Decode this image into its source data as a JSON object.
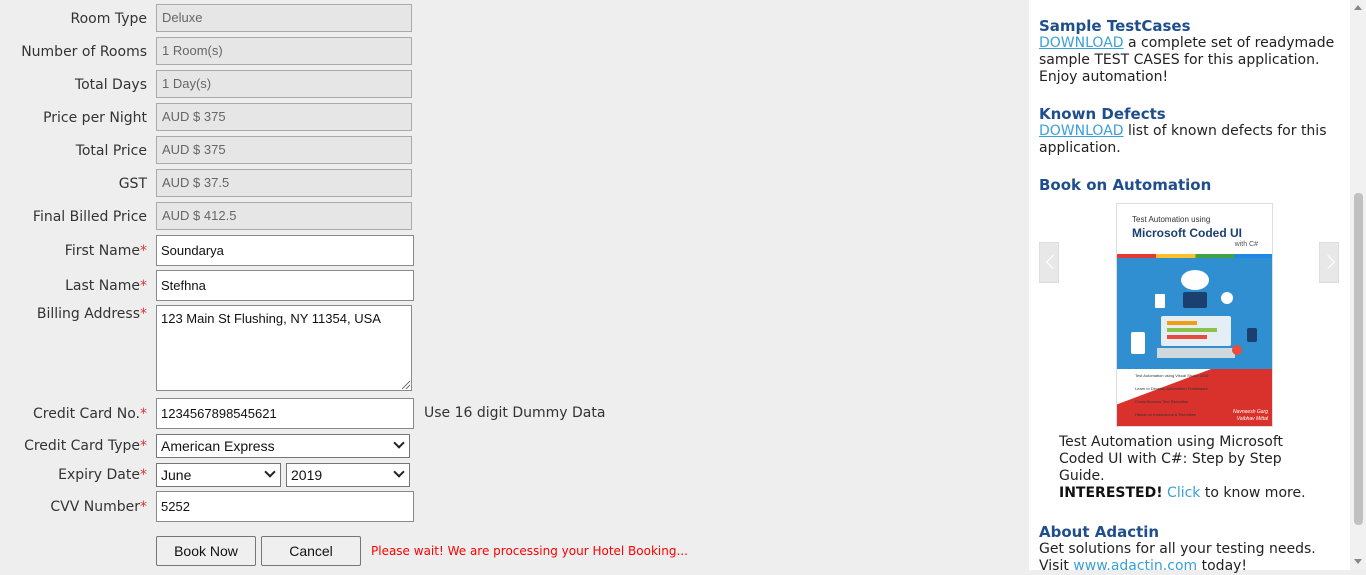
{
  "form": {
    "room_type": {
      "label": "Room Type",
      "value": "Deluxe"
    },
    "number_of_rooms": {
      "label": "Number of Rooms",
      "value": "1 Room(s)"
    },
    "total_days": {
      "label": "Total Days",
      "value": "1 Day(s)"
    },
    "price_per_night": {
      "label": "Price per Night",
      "value": "AUD $ 375"
    },
    "total_price": {
      "label": "Total Price",
      "value": "AUD $ 375"
    },
    "gst": {
      "label": "GST",
      "value": "AUD $ 37.5"
    },
    "final_billed_price": {
      "label": "Final Billed Price",
      "value": "AUD $ 412.5"
    },
    "first_name": {
      "label": "First Name",
      "value": "Soundarya"
    },
    "last_name": {
      "label": "Last Name",
      "value": "Stefhna"
    },
    "billing_address": {
      "label": "Billing Address",
      "value": "123 Main St Flushing, NY 11354, USA"
    },
    "credit_card_no": {
      "label": "Credit Card No.",
      "value": "1234567898545621",
      "hint": "Use 16 digit Dummy Data"
    },
    "credit_card_type": {
      "label": "Credit Card Type",
      "value": "American Express"
    },
    "expiry_date": {
      "label": "Expiry Date",
      "month": "June",
      "year": "2019"
    },
    "cvv_number": {
      "label": "CVV Number",
      "value": "5252"
    },
    "required_mark": "*",
    "book_now_label": "Book Now",
    "cancel_label": "Cancel",
    "processing_message": "Please wait! We are processing your Hotel Booking..."
  },
  "sidebar": {
    "sample_testcases": {
      "heading": "Sample TestCases",
      "link": "DOWNLOAD",
      "text": " a complete set of readymade sample TEST CASES for this application. Enjoy automation!"
    },
    "known_defects": {
      "heading": "Known Defects",
      "link": "DOWNLOAD",
      "text": " list of known defects for this application."
    },
    "book": {
      "heading": "Book on Automation",
      "cover_line1": "Test Automation using",
      "cover_title": "Microsoft Coded UI",
      "cover_sub": "with C#",
      "cover_bullets": [
        "Test Automation using Visual Studio 2015",
        "Learn to Develop Automation Framework",
        "Cross Browser Test Execution",
        "Hands on Instructions & Exercises"
      ],
      "cover_authors": [
        "Navneesh Garg",
        "Vaibhav Mittal"
      ],
      "caption": "Test Automation using Microsoft Coded UI with C#: Step by Step Guide.",
      "interested": "INTERESTED!",
      "click": "Click",
      "know_more": " to know more."
    },
    "about": {
      "heading": "About Adactin",
      "text": "Get solutions for all your testing needs.",
      "visit": "Visit ",
      "url": "www.adactin.com",
      "tail": " today!"
    }
  },
  "colors": {
    "heading": "#1f4e8c",
    "link": "#3aa0d8",
    "required": "#dd3333",
    "processing": "#ff0000",
    "book_cover_red": "#d9312b",
    "book_cover_blue": "#2f8fd0"
  }
}
